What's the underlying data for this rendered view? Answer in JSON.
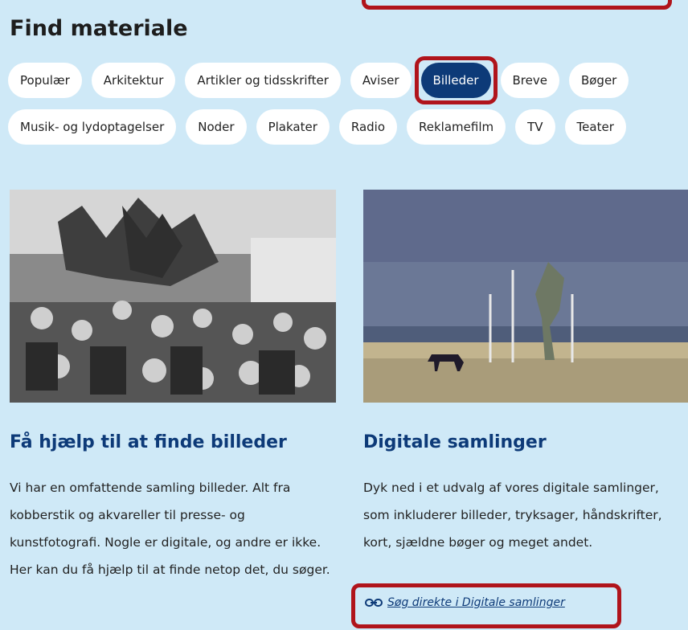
{
  "heading": "Find materiale",
  "categories_row1": [
    "Populær",
    "Arkitektur",
    "Artikler og tidsskrifter",
    "Aviser",
    "Billeder",
    "Breve",
    "Bøger"
  ],
  "categories_row2": [
    "Musik- og lydoptagelser",
    "Noder",
    "Plakater",
    "Radio",
    "Reklamefilm",
    "TV",
    "Teater"
  ],
  "active_category": "Billeder",
  "cards": [
    {
      "title": "Få hjælp til at finde billeder",
      "text": "Vi har en omfattende samling billeder. Alt fra kobberstik og akvareller til presse- og kunstfotografi. Nogle er digitale, og andre er ikke. Her kan du få hjælp til at finde netop det, du søger."
    },
    {
      "title": "Digitale samlinger",
      "text": "Dyk ned i et udvalg af vores digitale samlinger, som inkluderer billeder, tryksager, håndskrifter, kort, sjældne bøger og meget andet.",
      "link_label": "Søg direkte i Digitale samlinger"
    }
  ],
  "colors": {
    "background": "#cfe9f7",
    "accent": "#0d3a78",
    "highlight": "#b0141b"
  }
}
